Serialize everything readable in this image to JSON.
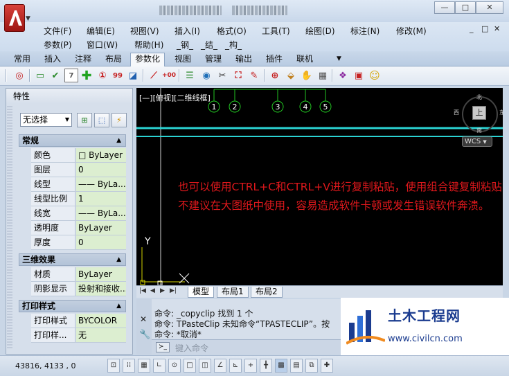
{
  "window": {
    "controls": {
      "minimize": "—",
      "restore": "□",
      "close": "✕"
    }
  },
  "menubar": {
    "row1": [
      "文件(F)",
      "编辑(E)",
      "视图(V)",
      "插入(I)",
      "格式(O)",
      "工具(T)",
      "绘图(D)",
      "标注(N)",
      "修改(M)"
    ],
    "row2": [
      "参数(P)",
      "窗口(W)",
      "帮助(H)",
      "_钢_",
      "_结_",
      "_构_"
    ],
    "mdi": {
      "minimize": "_",
      "restore": "□",
      "close": "✕"
    }
  },
  "ribbon": {
    "tabs": [
      "常用",
      "插入",
      "注释",
      "布局",
      "参数化",
      "视图",
      "管理",
      "输出",
      "插件",
      "联机",
      "▼"
    ],
    "active_tab": "参数化"
  },
  "properties": {
    "title": "特性",
    "selection": "无选择",
    "sections": [
      {
        "name": "常规",
        "rows": [
          {
            "k": "颜色",
            "v": "□ ByLayer"
          },
          {
            "k": "图层",
            "v": "0"
          },
          {
            "k": "线型",
            "v": "—— ByLa..."
          },
          {
            "k": "线型比例",
            "v": "1"
          },
          {
            "k": "线宽",
            "v": "—— ByLa..."
          },
          {
            "k": "透明度",
            "v": "ByLayer"
          },
          {
            "k": "厚度",
            "v": "0"
          }
        ]
      },
      {
        "name": "三维效果",
        "rows": [
          {
            "k": "材质",
            "v": "ByLayer"
          },
          {
            "k": "阴影显示",
            "v": "投射和接收..."
          }
        ]
      },
      {
        "name": "打印样式",
        "rows": [
          {
            "k": "打印样式",
            "v": "BYCOLOR"
          },
          {
            "k": "打印样...",
            "v": "无"
          }
        ]
      }
    ]
  },
  "viewport": {
    "label": "[—][俯视][二维线框]",
    "axis_numbers": [
      "1",
      "2",
      "3",
      "4",
      "5"
    ],
    "annotation": "也可以使用CTRL+C和CTRL+V进行复制粘贴，使用组合键复制粘贴不建议在大图纸中使用，容易造成软件卡顿或发生错误软件奔溃。",
    "compass": {
      "n": "北",
      "s": "南",
      "e": "东",
      "w": "西",
      "top": "上"
    },
    "wcs": "WCS",
    "ucs_y": "Y",
    "accent": "#e0181c"
  },
  "layout_tabs": [
    "模型",
    "布局1",
    "布局2"
  ],
  "command": {
    "lines": [
      "命令:  _copyclip 找到 1 个",
      "命令:  TPasteClip 未知命令“TPASTECLIP”。按",
      "命令:  *取消*"
    ],
    "placeholder": "键入命令"
  },
  "watermark": {
    "name": "土木工程网",
    "url": "www.civilcn.com"
  },
  "status": {
    "coords": "43816, 4133 , 0"
  }
}
